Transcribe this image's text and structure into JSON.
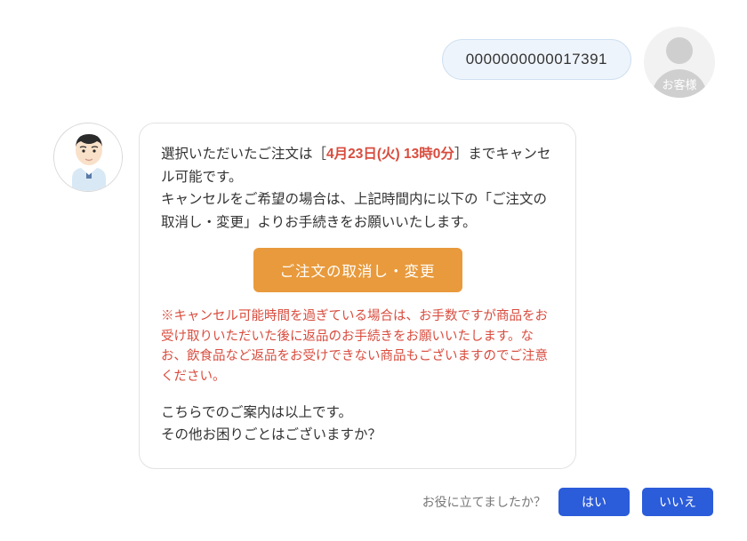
{
  "customer": {
    "message": "0000000000017391",
    "avatar_label": "お客様"
  },
  "agent": {
    "text_before_date": "選択いただいたご注文は［",
    "deadline": "4月23日(火) 13時0分",
    "text_after_date": "］までキャンセル可能です。",
    "instruction": "キャンセルをご希望の場合は、上記時間内に以下の「ご注文の取消し・変更」よりお手続きをお願いいたします。",
    "button_label": "ご注文の取消し・変更",
    "warning": "※キャンセル可能時間を過ぎている場合は、お手数ですが商品をお受け取りいただいた後に返品のお手続きをお願いいたします。なお、飲食品など返品をお受けできない商品もございますのでご注意ください。",
    "closing_1": "こちらでのご案内は以上です。",
    "closing_2": "その他お困りごとはございますか？"
  },
  "feedback": {
    "label": "お役に立てましたか？",
    "yes": "はい",
    "no": "いいえ"
  }
}
